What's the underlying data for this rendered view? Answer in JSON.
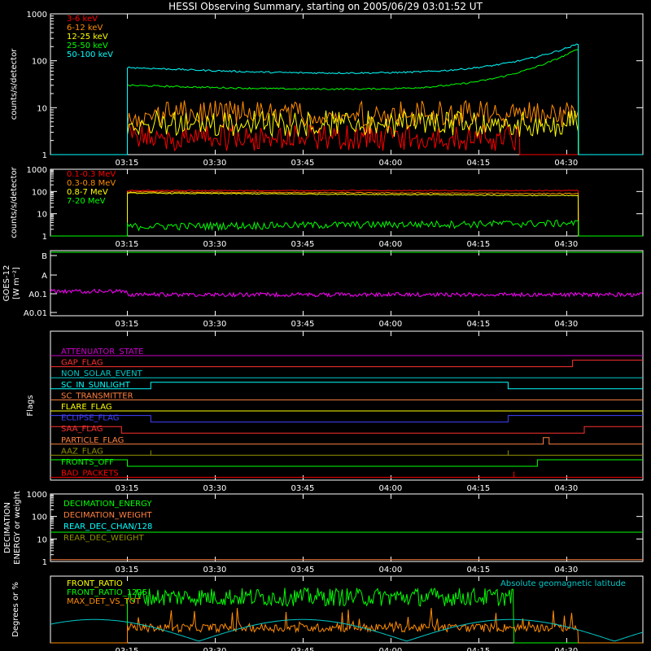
{
  "title": "HESSI Observing Summary, starting on 2005/06/29 03:01:52 UT",
  "time_ticks": [
    "03:15",
    "03:30",
    "03:45",
    "04:00",
    "04:15",
    "04:30"
  ],
  "chart_data": [
    {
      "type": "line",
      "panel": "count_rates_low",
      "ylabel": "counts/s/detector",
      "yscale": "log",
      "ylim": [
        1,
        1000
      ],
      "yticks": [
        "1",
        "10",
        "100",
        "1000"
      ],
      "xlim": [
        "03:01:52",
        "04:43"
      ],
      "grid": false,
      "legend": "top-left",
      "series": [
        {
          "name": "3-6 keV",
          "color": "#ff0000",
          "start": "03:15",
          "end": "04:22",
          "level": 2.0,
          "noise": "bursty"
        },
        {
          "name": "6-12 keV",
          "color": "#ff8c00",
          "start": "03:15",
          "end": "04:32",
          "level": 6.5,
          "noise": "bursty"
        },
        {
          "name": "12-25 keV",
          "color": "#ffff00",
          "start": "03:15",
          "end": "04:32",
          "level": 4.0,
          "noise": "bursty"
        },
        {
          "name": "25-50 keV",
          "color": "#00ff00",
          "start": "03:15",
          "end": "04:32",
          "start_value": 30,
          "min_value": 25,
          "end_value": 180
        },
        {
          "name": "50-100 keV",
          "color": "#00ffff",
          "start": "03:15",
          "end": "04:32",
          "start_value": 72,
          "min_value": 55,
          "end_value": 230
        }
      ]
    },
    {
      "type": "line",
      "panel": "count_rates_high",
      "ylabel": "counts/s/detector",
      "yscale": "log",
      "ylim": [
        1,
        1000
      ],
      "yticks": [
        "1",
        "10",
        "100",
        "1000"
      ],
      "legend": "top-left",
      "series": [
        {
          "name": "0.1-0.3 MeV",
          "color": "#ff0000",
          "start": "03:15",
          "end": "04:32",
          "start_value": 110,
          "end_value": 110
        },
        {
          "name": "0.3-0.8 MeV",
          "color": "#ff8c00",
          "start": "03:15",
          "end": "04:32",
          "start_value": 95,
          "end_value": 80
        },
        {
          "name": "0.8-7 MeV",
          "color": "#ffff00",
          "start": "03:15",
          "end": "04:32",
          "start_value": 85,
          "end_value": 65
        },
        {
          "name": "7-20 MeV",
          "color": "#00ff00",
          "start": "03:15",
          "end": "04:32",
          "start_value": 2.5,
          "end_value": 3.5
        }
      ]
    },
    {
      "type": "line",
      "panel": "goes",
      "ylabel": "GOES-12",
      "ylabel2": "[W m⁻²]",
      "yticks": [
        "A0.01",
        "A0.1",
        "A",
        "B"
      ],
      "series": [
        {
          "name": "GOES flux",
          "color": "#ff00ff",
          "level": "A0.1"
        },
        {
          "name": "B level",
          "color": "#00ff00",
          "level": "B"
        }
      ]
    },
    {
      "type": "line",
      "panel": "flags",
      "ylabel": "Flags",
      "flags": [
        {
          "name": "ATTENUATOR_STATE",
          "color": "#cc00cc",
          "states": [
            [
              0,
              "04:43",
              0
            ]
          ]
        },
        {
          "name": "GAP_FLAG",
          "color": "#ff3030",
          "states": [
            [
              "03:01:52",
              "04:31",
              0
            ],
            [
              "04:31",
              "04:43",
              1
            ]
          ]
        },
        {
          "name": "NON_SOLAR_EVENT",
          "color": "#00c8c8",
          "states": [
            [
              "03:01:52",
              "04:43",
              0
            ]
          ]
        },
        {
          "name": "SC_IN_SUNLIGHT",
          "color": "#00ffff",
          "states": [
            [
              "03:01:52",
              "03:19",
              0
            ],
            [
              "03:19",
              "04:20",
              1
            ],
            [
              "04:20",
              "04:43",
              0
            ]
          ]
        },
        {
          "name": "SC_TRANSMITTER",
          "color": "#ff8040",
          "states": [
            [
              "03:01:52",
              "04:43",
              0
            ]
          ]
        },
        {
          "name": "FLARE_FLAG",
          "color": "#ffff00",
          "states": [
            [
              "03:01:52",
              "04:43",
              0
            ]
          ]
        },
        {
          "name": "ECLIPSE_FLAG",
          "color": "#4040ff",
          "states": [
            [
              "03:01:52",
              "03:19",
              1
            ],
            [
              "03:19",
              "04:20",
              0
            ],
            [
              "04:20",
              "04:43",
              1
            ]
          ]
        },
        {
          "name": "SAA_FLAG",
          "color": "#ff3030",
          "states": [
            [
              "03:01:52",
              "03:14",
              1
            ],
            [
              "03:14",
              "04:33",
              0
            ],
            [
              "04:33",
              "04:43",
              1
            ]
          ]
        },
        {
          "name": "PARTICLE_FLAG",
          "color": "#ff8040",
          "states": [
            [
              "03:01:52",
              "04:26",
              0
            ],
            [
              "04:26",
              "04:27",
              1
            ],
            [
              "04:27",
              "04:43",
              0
            ]
          ]
        },
        {
          "name": "AAZ_FLAG",
          "color": "#909000",
          "states": [
            [
              "03:01:52",
              "04:43",
              0
            ]
          ]
        },
        {
          "name": "FRONTS_OFF",
          "color": "#00ff00",
          "states": [
            [
              "03:01:52",
              "03:15",
              1
            ],
            [
              "03:15",
              "04:25",
              0
            ],
            [
              "04:25",
              "04:43",
              1
            ]
          ]
        },
        {
          "name": "BAD_PACKETS",
          "color": "#ff0000",
          "states": [
            [
              "03:01:52",
              "04:43",
              0
            ]
          ]
        }
      ]
    },
    {
      "type": "line",
      "panel": "decimation",
      "ylabel": "DECIMATION",
      "ylabel2": "ENERGY or weight",
      "yscale": "log",
      "ylim": [
        1,
        1000
      ],
      "yticks": [
        "1",
        "10",
        "100",
        "1000"
      ],
      "series": [
        {
          "name": "DECIMATION_ENERGY",
          "color": "#00ff00",
          "value": 20
        },
        {
          "name": "DECIMATION_WEIGHT",
          "color": "#ff8040",
          "value": 1.2
        },
        {
          "name": "REAR_DEC_CHAN/128",
          "color": "#00ffff",
          "value": null
        },
        {
          "name": "REAR_DEC_WEIGHT",
          "color": "#909000",
          "value": null
        }
      ]
    },
    {
      "type": "line",
      "panel": "ratios",
      "ylabel": "Degrees or %",
      "annotation": "Absolute geomagnetic latitude",
      "series": [
        {
          "name": "FRONT_RATIO",
          "color": "#ffff00"
        },
        {
          "name": "FRONT_RATIO_1225",
          "color": "#00ff00",
          "start": "03:15",
          "end": "04:21",
          "level": 55
        },
        {
          "name": "MAX_DET_VS_TOT",
          "color": "#ff8c00",
          "start": "03:15",
          "end": "04:32",
          "level": 18
        },
        {
          "name": "Absolute geomagnetic latitude",
          "color": "#00c8c8"
        }
      ]
    }
  ]
}
